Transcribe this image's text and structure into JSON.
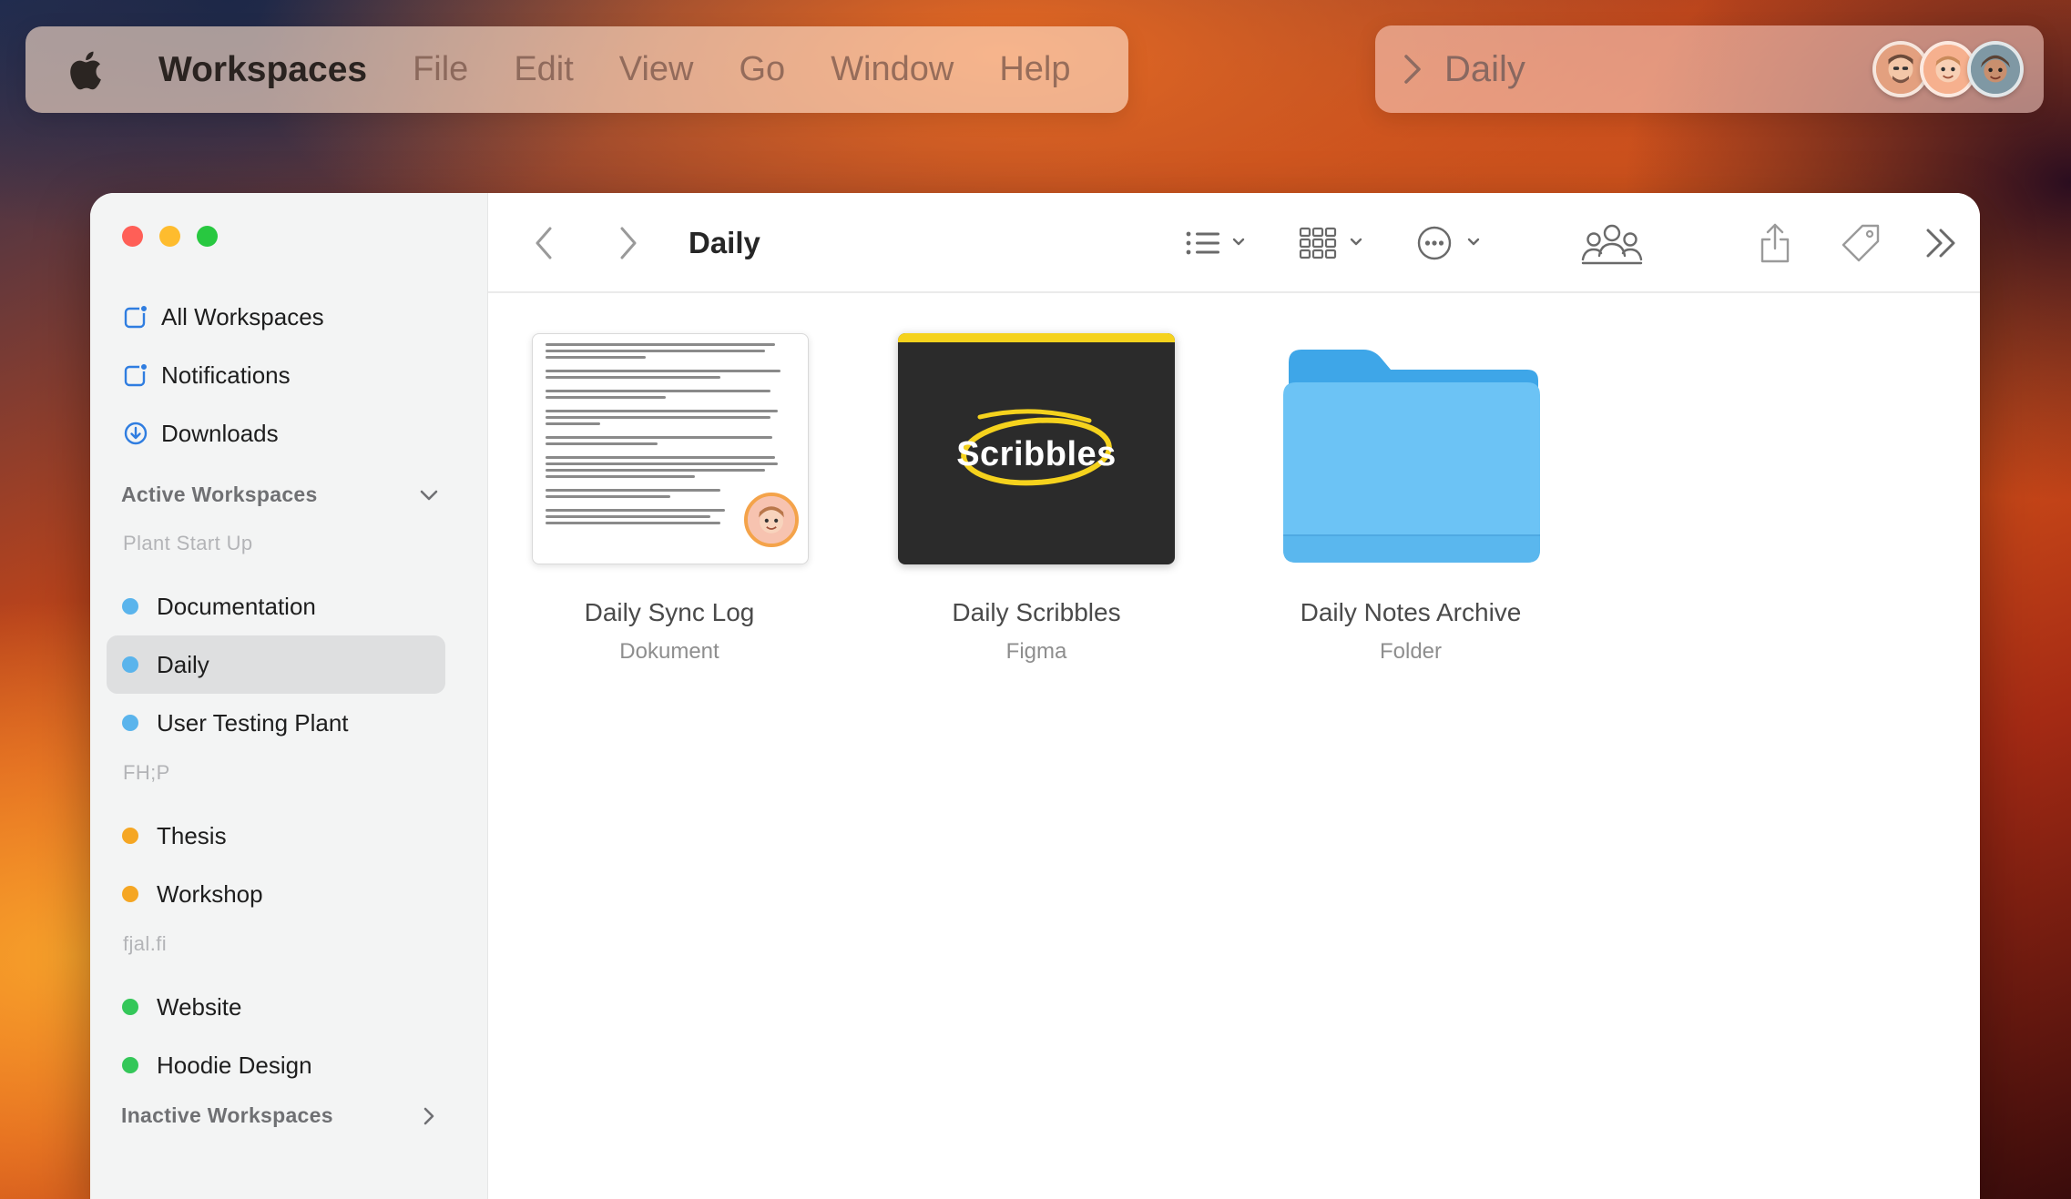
{
  "menubar": {
    "app_name": "Workspaces",
    "items": [
      "File",
      "Edit",
      "View",
      "Go",
      "Window",
      "Help"
    ]
  },
  "pathbar": {
    "current": "Daily"
  },
  "sidebar": {
    "top_items": [
      {
        "label": "All Workspaces",
        "icon": "square-badge-icon"
      },
      {
        "label": "Notifications",
        "icon": "square-badge-icon"
      },
      {
        "label": "Downloads",
        "icon": "download-circle-icon"
      }
    ],
    "active_section": "Active Workspaces",
    "groups": [
      {
        "name": "Plant Start Up",
        "items": [
          {
            "label": "Documentation",
            "color": "#5ab4ec"
          },
          {
            "label": "Daily",
            "color": "#5ab4ec",
            "selected": true
          },
          {
            "label": "User Testing Plant",
            "color": "#5ab4ec"
          }
        ]
      },
      {
        "name": "FH;P",
        "items": [
          {
            "label": "Thesis",
            "color": "#f5a623"
          },
          {
            "label": "Workshop",
            "color": "#f5a623"
          }
        ]
      },
      {
        "name": "fjal.fi",
        "items": [
          {
            "label": "Website",
            "color": "#34c759"
          },
          {
            "label": "Hoodie Design",
            "color": "#34c759"
          }
        ]
      }
    ],
    "inactive_section": "Inactive Workspaces"
  },
  "toolbar": {
    "title": "Daily"
  },
  "files": [
    {
      "name": "Daily Sync Log",
      "kind": "Dokument"
    },
    {
      "name": "Daily Scribbles",
      "kind": "Figma",
      "thumb_text": "Scribbles"
    },
    {
      "name": "Daily Notes Archive",
      "kind": "Folder"
    }
  ],
  "colors": {
    "folder": "#6cc3f5",
    "folder_tab": "#3ea6e8",
    "scribbles_accent": "#f5d21d"
  }
}
